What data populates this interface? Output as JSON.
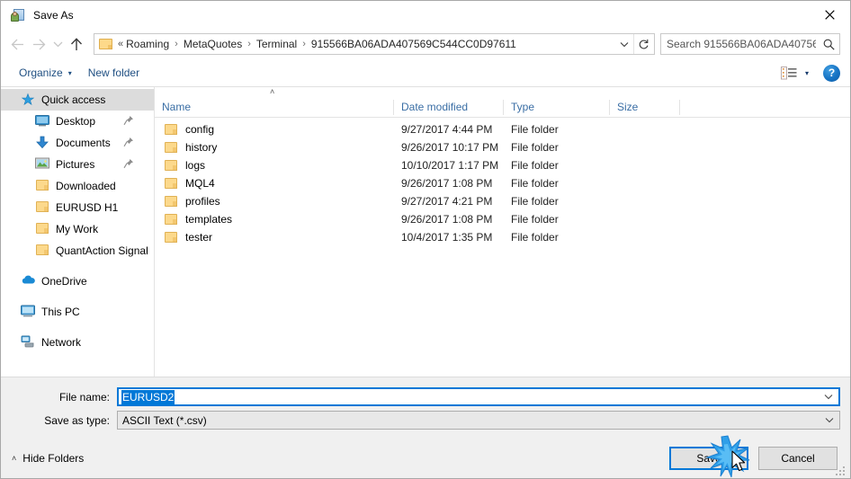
{
  "window": {
    "title": "Save As",
    "icon": "save-as-app-icon",
    "close_label": "✕"
  },
  "navigation": {
    "back_icon": "arrow-left-icon",
    "forward_icon": "arrow-right-icon",
    "recent_icon": "chevron-down-icon",
    "up_icon": "arrow-up-icon",
    "breadcrumb": {
      "folder_icon": "folder-icon",
      "leading": "«",
      "segments": [
        "Roaming",
        "MetaQuotes",
        "Terminal",
        "915566BA06ADA407569C544CC0D97611"
      ],
      "separator": "›",
      "dropdown_icon": "chevron-down-icon",
      "refresh_icon": "refresh-icon"
    },
    "search": {
      "placeholder": "Search 915566BA06ADA40756...",
      "value": "",
      "icon": "search-icon"
    }
  },
  "toolbar": {
    "organize_label": "Organize",
    "organize_caret": "▾",
    "new_folder_label": "New folder",
    "view_icon": "view-options-icon",
    "view_caret": "▾",
    "help_label": "?",
    "help_icon": "help-icon"
  },
  "sidebar": {
    "items": [
      {
        "label": "Quick access",
        "icon": "star-pin-icon",
        "selected": true,
        "indent": false,
        "pinned": false
      },
      {
        "label": "Desktop",
        "icon": "desktop-icon",
        "selected": false,
        "indent": true,
        "pinned": true
      },
      {
        "label": "Documents",
        "icon": "documents-download-icon",
        "selected": false,
        "indent": true,
        "pinned": true
      },
      {
        "label": "Pictures",
        "icon": "pictures-icon",
        "selected": false,
        "indent": true,
        "pinned": true
      },
      {
        "label": "Downloaded",
        "icon": "folder-icon",
        "selected": false,
        "indent": true,
        "pinned": false
      },
      {
        "label": "EURUSD H1",
        "icon": "folder-icon",
        "selected": false,
        "indent": true,
        "pinned": false
      },
      {
        "label": "My Work",
        "icon": "folder-icon",
        "selected": false,
        "indent": true,
        "pinned": false
      },
      {
        "label": "QuantAction Signal",
        "icon": "folder-icon",
        "selected": false,
        "indent": true,
        "pinned": false
      },
      {
        "label": "OneDrive",
        "icon": "onedrive-cloud-icon",
        "selected": false,
        "indent": false,
        "pinned": false,
        "gap_before": true
      },
      {
        "label": "This PC",
        "icon": "this-pc-icon",
        "selected": false,
        "indent": false,
        "pinned": false,
        "gap_before": true
      },
      {
        "label": "Network",
        "icon": "network-icon",
        "selected": false,
        "indent": false,
        "pinned": false,
        "gap_before": true
      }
    ]
  },
  "filelist": {
    "sort_indicator": "˄",
    "columns": [
      "Name",
      "Date modified",
      "Type",
      "Size"
    ],
    "rows": [
      {
        "name": "config",
        "date": "9/27/2017 4:44 PM",
        "type": "File folder",
        "size": ""
      },
      {
        "name": "history",
        "date": "9/26/2017 10:17 PM",
        "type": "File folder",
        "size": ""
      },
      {
        "name": "logs",
        "date": "10/10/2017 1:17 PM",
        "type": "File folder",
        "size": ""
      },
      {
        "name": "MQL4",
        "date": "9/26/2017 1:08 PM",
        "type": "File folder",
        "size": ""
      },
      {
        "name": "profiles",
        "date": "9/27/2017 4:21 PM",
        "type": "File folder",
        "size": ""
      },
      {
        "name": "templates",
        "date": "9/26/2017 1:08 PM",
        "type": "File folder",
        "size": ""
      },
      {
        "name": "tester",
        "date": "10/4/2017 1:35 PM",
        "type": "File folder",
        "size": ""
      }
    ]
  },
  "form": {
    "filename_label": "File name:",
    "filename_value": "EURUSD2",
    "filename_caret": "⌄",
    "filetype_label": "Save as type:",
    "filetype_value": "ASCII Text (*.csv)",
    "filetype_caret": "⌄"
  },
  "footer": {
    "hide_folders_caret": "˄",
    "hide_folders_label": "Hide Folders",
    "save_label": "Save",
    "cancel_label": "Cancel"
  },
  "colors": {
    "accent": "#0078d7",
    "toolbar_link": "#1f4f82",
    "column_header": "#3a6ea5",
    "selection_bg": "#dcdcdc",
    "folder_yellow": "#fcd98c",
    "form_bg": "#f0f0f0"
  }
}
